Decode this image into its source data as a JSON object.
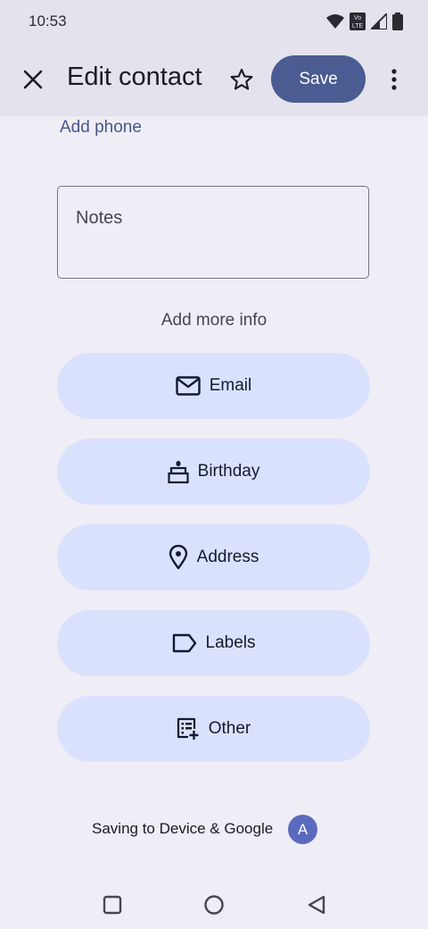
{
  "status_bar": {
    "time": "10:53",
    "icons": [
      "wifi-icon",
      "volte-icon",
      "signal-icon",
      "battery-icon"
    ],
    "volte_line1": "Vo",
    "volte_line2": "LTE"
  },
  "header": {
    "title": "Edit contact",
    "save_label": "Save",
    "icons": {
      "close": "close-icon",
      "star": "star-outline-icon",
      "more": "more-vert-icon"
    }
  },
  "form": {
    "add_phone_label": "Add phone",
    "notes_label": "Notes",
    "add_more_info_label": "Add more info",
    "more_info_buttons": [
      {
        "label": "Email",
        "icon": "mail-icon"
      },
      {
        "label": "Birthday",
        "icon": "cake-icon"
      },
      {
        "label": "Address",
        "icon": "location-pin-icon"
      },
      {
        "label": "Labels",
        "icon": "label-icon"
      },
      {
        "label": "Other",
        "icon": "list-add-icon"
      }
    ]
  },
  "footer": {
    "saving_to": "Saving to Device & Google",
    "account_initial": "A"
  },
  "colors": {
    "background": "#efedf6",
    "top_bar": "#e4e2ec",
    "primary_button": "#4b5c92",
    "pill": "#dae1fc",
    "link": "#46578c",
    "avatar": "#5a6bbf"
  }
}
